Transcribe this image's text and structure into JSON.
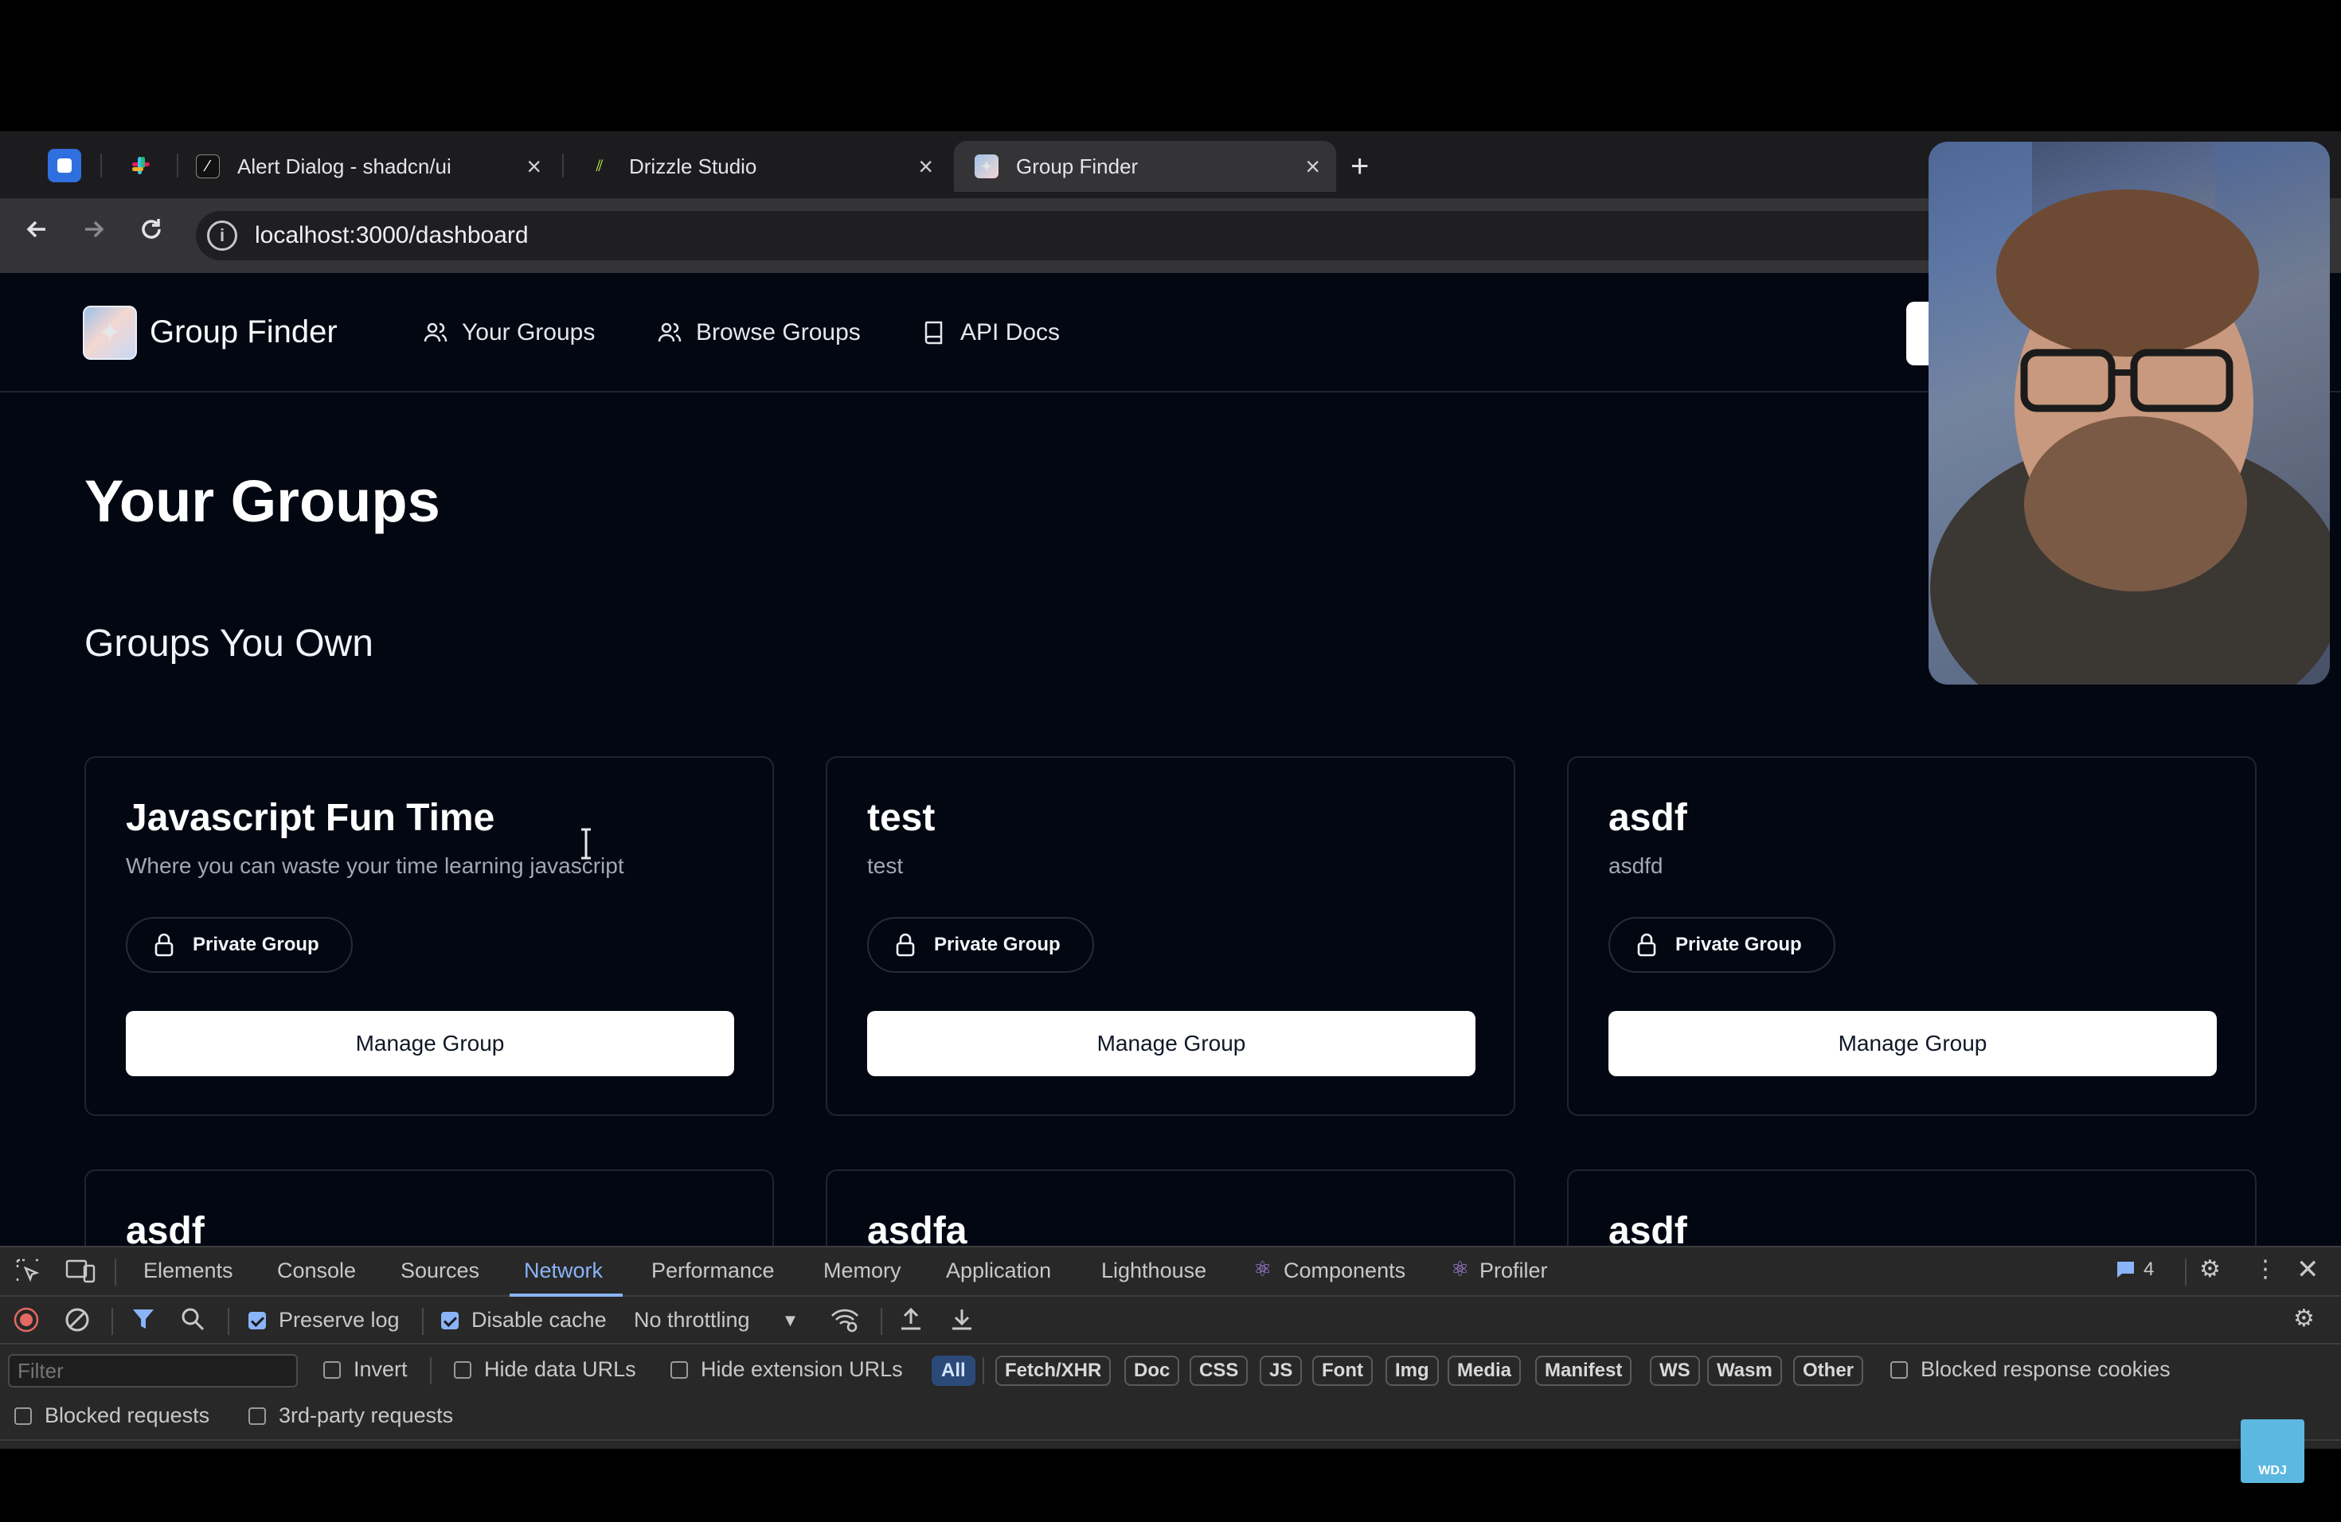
{
  "browser": {
    "tabs": [
      {
        "title": "Alert Dialog - shadcn/ui"
      },
      {
        "title": "Drizzle Studio"
      },
      {
        "title": "Group Finder"
      }
    ],
    "new_tab_label": "+",
    "close_glyph": "×",
    "url": "localhost:3000/dashboard"
  },
  "app": {
    "brand": "Group Finder",
    "nav": [
      {
        "label": "Your Groups",
        "icon": "users-icon"
      },
      {
        "label": "Browse Groups",
        "icon": "users-icon"
      },
      {
        "label": "API Docs",
        "icon": "book-icon"
      }
    ]
  },
  "main": {
    "title": "Your Groups",
    "section_title": "Groups You Own",
    "groups": [
      {
        "name": "Javascript Fun Time",
        "description": "Where you can waste your time learning javascript",
        "badge": "Private Group",
        "action": "Manage Group"
      },
      {
        "name": "test",
        "description": "test",
        "badge": "Private Group",
        "action": "Manage Group"
      },
      {
        "name": "asdf",
        "description": "asdfd",
        "badge": "Private Group",
        "action": "Manage Group"
      },
      {
        "name": "asdf"
      },
      {
        "name": "asdfa"
      },
      {
        "name": "asdf"
      }
    ]
  },
  "devtools": {
    "tabs": [
      "Elements",
      "Console",
      "Sources",
      "Network",
      "Performance",
      "Memory",
      "Application",
      "Lighthouse",
      "Components",
      "Profiler"
    ],
    "active_tab": "Network",
    "issues_count": "4",
    "preserve_log": "Preserve log",
    "disable_cache": "Disable cache",
    "throttling": "No throttling",
    "filter_placeholder": "Filter",
    "invert": "Invert",
    "hide_data_urls": "Hide data URLs",
    "hide_extension_urls": "Hide extension URLs",
    "type_filters": [
      "All",
      "Fetch/XHR",
      "Doc",
      "CSS",
      "JS",
      "Font",
      "Img",
      "Media",
      "Manifest",
      "WS",
      "Wasm",
      "Other"
    ],
    "blocked_response_cookies": "Blocked response cookies",
    "blocked_requests": "Blocked requests",
    "third_party_requests": "3rd-party requests"
  },
  "watermark": "WDJ",
  "colors": {
    "page_bg": "#030712",
    "devtools_accent": "#8ab4f8",
    "button_bg": "#ffffff"
  }
}
